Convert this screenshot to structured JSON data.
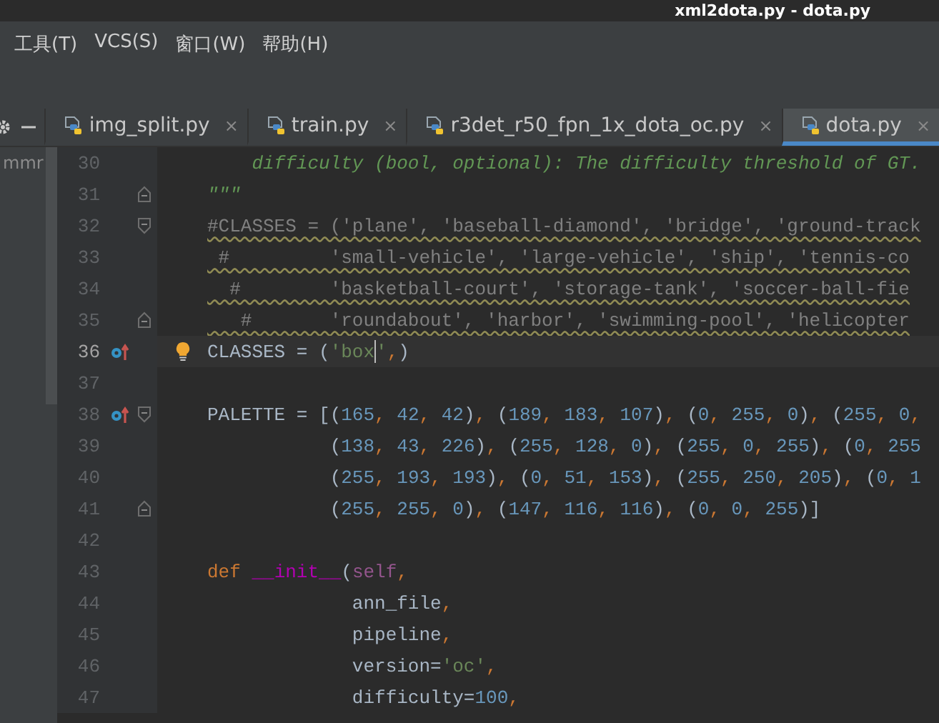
{
  "window": {
    "title": "xml2dota.py - dota.py"
  },
  "menu": [
    {
      "label": "工具(T)"
    },
    {
      "label": "VCS(S)"
    },
    {
      "label": "窗口(W)"
    },
    {
      "label": "帮助(H)"
    }
  ],
  "tabs": [
    {
      "label": "img_split.py",
      "close": "×",
      "selected": false
    },
    {
      "label": "train.py",
      "close": "×",
      "selected": false
    },
    {
      "label": "r3det_r50_fpn_1x_dota_oc.py",
      "close": "×",
      "selected": false
    },
    {
      "label": "dota.py",
      "close": "×",
      "selected": true
    }
  ],
  "project_panel": {
    "text": "mmr"
  },
  "editor": {
    "lines": [
      {
        "number": "30",
        "tokens": [
          {
            "kind": "doc",
            "text": "    difficulty (bool, optional): The difficulty threshold of GT."
          }
        ]
      },
      {
        "number": "31",
        "fold_end": true,
        "tokens": [
          {
            "kind": "doc",
            "text": "\"\"\""
          }
        ]
      },
      {
        "number": "32",
        "fold_start": true,
        "warning": true,
        "tokens": [
          {
            "kind": "comment",
            "text": "#CLASSES = ('plane', 'baseball-diamond', 'bridge', 'ground-track"
          }
        ]
      },
      {
        "number": "33",
        "warning": true,
        "tokens": [
          {
            "kind": "comment",
            "text": " #         'small-vehicle', 'large-vehicle', 'ship', 'tennis-co"
          }
        ]
      },
      {
        "number": "34",
        "warning": true,
        "tokens": [
          {
            "kind": "comment",
            "text": "  #        'basketball-court', 'storage-tank', 'soccer-ball-fie"
          }
        ]
      },
      {
        "number": "35",
        "fold_end": true,
        "warning": true,
        "tokens": [
          {
            "kind": "comment",
            "text": "   #       'roundabout', 'harbor', 'swimming-pool', 'helicopter"
          }
        ]
      },
      {
        "number": "36",
        "current": true,
        "override_marker": true,
        "bulb": true,
        "tokens": [
          {
            "kind": "plain",
            "text": "CLASSES = ("
          },
          {
            "kind": "string",
            "text": "'box"
          },
          {
            "kind": "string",
            "text": "'",
            "caret_before": true
          },
          {
            "kind": "punct",
            "text": ","
          },
          {
            "kind": "plain",
            "text": ")"
          }
        ]
      },
      {
        "number": "37"
      },
      {
        "number": "38",
        "override_marker": true,
        "fold_start": true,
        "tokens": [
          {
            "kind": "plain",
            "text": "PALETTE = [("
          },
          {
            "kind": "number",
            "text": "165"
          },
          {
            "kind": "punct",
            "text": ", "
          },
          {
            "kind": "number",
            "text": "42"
          },
          {
            "kind": "punct",
            "text": ", "
          },
          {
            "kind": "number",
            "text": "42"
          },
          {
            "kind": "plain",
            "text": ")"
          },
          {
            "kind": "punct",
            "text": ", "
          },
          {
            "kind": "plain",
            "text": "("
          },
          {
            "kind": "number",
            "text": "189"
          },
          {
            "kind": "punct",
            "text": ", "
          },
          {
            "kind": "number",
            "text": "183"
          },
          {
            "kind": "punct",
            "text": ", "
          },
          {
            "kind": "number",
            "text": "107"
          },
          {
            "kind": "plain",
            "text": ")"
          },
          {
            "kind": "punct",
            "text": ", "
          },
          {
            "kind": "plain",
            "text": "("
          },
          {
            "kind": "number",
            "text": "0"
          },
          {
            "kind": "punct",
            "text": ", "
          },
          {
            "kind": "number",
            "text": "255"
          },
          {
            "kind": "punct",
            "text": ", "
          },
          {
            "kind": "number",
            "text": "0"
          },
          {
            "kind": "plain",
            "text": ")"
          },
          {
            "kind": "punct",
            "text": ", "
          },
          {
            "kind": "plain",
            "text": "("
          },
          {
            "kind": "number",
            "text": "255"
          },
          {
            "kind": "punct",
            "text": ", "
          },
          {
            "kind": "number",
            "text": "0"
          },
          {
            "kind": "punct",
            "text": ","
          }
        ]
      },
      {
        "number": "39",
        "tokens": [
          {
            "kind": "plain",
            "text": "           ("
          },
          {
            "kind": "number",
            "text": "138"
          },
          {
            "kind": "punct",
            "text": ", "
          },
          {
            "kind": "number",
            "text": "43"
          },
          {
            "kind": "punct",
            "text": ", "
          },
          {
            "kind": "number",
            "text": "226"
          },
          {
            "kind": "plain",
            "text": ")"
          },
          {
            "kind": "punct",
            "text": ", "
          },
          {
            "kind": "plain",
            "text": "("
          },
          {
            "kind": "number",
            "text": "255"
          },
          {
            "kind": "punct",
            "text": ", "
          },
          {
            "kind": "number",
            "text": "128"
          },
          {
            "kind": "punct",
            "text": ", "
          },
          {
            "kind": "number",
            "text": "0"
          },
          {
            "kind": "plain",
            "text": ")"
          },
          {
            "kind": "punct",
            "text": ", "
          },
          {
            "kind": "plain",
            "text": "("
          },
          {
            "kind": "number",
            "text": "255"
          },
          {
            "kind": "punct",
            "text": ", "
          },
          {
            "kind": "number",
            "text": "0"
          },
          {
            "kind": "punct",
            "text": ", "
          },
          {
            "kind": "number",
            "text": "255"
          },
          {
            "kind": "plain",
            "text": ")"
          },
          {
            "kind": "punct",
            "text": ", "
          },
          {
            "kind": "plain",
            "text": "("
          },
          {
            "kind": "number",
            "text": "0"
          },
          {
            "kind": "punct",
            "text": ", "
          },
          {
            "kind": "number",
            "text": "255"
          }
        ]
      },
      {
        "number": "40",
        "tokens": [
          {
            "kind": "plain",
            "text": "           ("
          },
          {
            "kind": "number",
            "text": "255"
          },
          {
            "kind": "punct",
            "text": ", "
          },
          {
            "kind": "number",
            "text": "193"
          },
          {
            "kind": "punct",
            "text": ", "
          },
          {
            "kind": "number",
            "text": "193"
          },
          {
            "kind": "plain",
            "text": ")"
          },
          {
            "kind": "punct",
            "text": ", "
          },
          {
            "kind": "plain",
            "text": "("
          },
          {
            "kind": "number",
            "text": "0"
          },
          {
            "kind": "punct",
            "text": ", "
          },
          {
            "kind": "number",
            "text": "51"
          },
          {
            "kind": "punct",
            "text": ", "
          },
          {
            "kind": "number",
            "text": "153"
          },
          {
            "kind": "plain",
            "text": ")"
          },
          {
            "kind": "punct",
            "text": ", "
          },
          {
            "kind": "plain",
            "text": "("
          },
          {
            "kind": "number",
            "text": "255"
          },
          {
            "kind": "punct",
            "text": ", "
          },
          {
            "kind": "number",
            "text": "250"
          },
          {
            "kind": "punct",
            "text": ", "
          },
          {
            "kind": "number",
            "text": "205"
          },
          {
            "kind": "plain",
            "text": ")"
          },
          {
            "kind": "punct",
            "text": ", "
          },
          {
            "kind": "plain",
            "text": "("
          },
          {
            "kind": "number",
            "text": "0"
          },
          {
            "kind": "punct",
            "text": ", "
          },
          {
            "kind": "number",
            "text": "1"
          }
        ]
      },
      {
        "number": "41",
        "fold_end": true,
        "tokens": [
          {
            "kind": "plain",
            "text": "           ("
          },
          {
            "kind": "number",
            "text": "255"
          },
          {
            "kind": "punct",
            "text": ", "
          },
          {
            "kind": "number",
            "text": "255"
          },
          {
            "kind": "punct",
            "text": ", "
          },
          {
            "kind": "number",
            "text": "0"
          },
          {
            "kind": "plain",
            "text": ")"
          },
          {
            "kind": "punct",
            "text": ", "
          },
          {
            "kind": "plain",
            "text": "("
          },
          {
            "kind": "number",
            "text": "147"
          },
          {
            "kind": "punct",
            "text": ", "
          },
          {
            "kind": "number",
            "text": "116"
          },
          {
            "kind": "punct",
            "text": ", "
          },
          {
            "kind": "number",
            "text": "116"
          },
          {
            "kind": "plain",
            "text": ")"
          },
          {
            "kind": "punct",
            "text": ", "
          },
          {
            "kind": "plain",
            "text": "("
          },
          {
            "kind": "number",
            "text": "0"
          },
          {
            "kind": "punct",
            "text": ", "
          },
          {
            "kind": "number",
            "text": "0"
          },
          {
            "kind": "punct",
            "text": ", "
          },
          {
            "kind": "number",
            "text": "255"
          },
          {
            "kind": "plain",
            "text": ")]"
          }
        ]
      },
      {
        "number": "42"
      },
      {
        "number": "43",
        "tokens": [
          {
            "kind": "keyword",
            "text": "def "
          },
          {
            "kind": "magic",
            "text": "__init__"
          },
          {
            "kind": "plain",
            "text": "("
          },
          {
            "kind": "self",
            "text": "self"
          },
          {
            "kind": "punct",
            "text": ","
          }
        ]
      },
      {
        "number": "44",
        "tokens": [
          {
            "kind": "plain",
            "text": "             ann_file"
          },
          {
            "kind": "punct",
            "text": ","
          }
        ]
      },
      {
        "number": "45",
        "tokens": [
          {
            "kind": "plain",
            "text": "             pipeline"
          },
          {
            "kind": "punct",
            "text": ","
          }
        ]
      },
      {
        "number": "46",
        "tokens": [
          {
            "kind": "plain",
            "text": "             version="
          },
          {
            "kind": "string",
            "text": "'oc'"
          },
          {
            "kind": "punct",
            "text": ","
          }
        ]
      },
      {
        "number": "47",
        "tokens": [
          {
            "kind": "plain",
            "text": "             difficulty="
          },
          {
            "kind": "number",
            "text": "100"
          },
          {
            "kind": "punct",
            "text": ","
          }
        ]
      }
    ]
  }
}
